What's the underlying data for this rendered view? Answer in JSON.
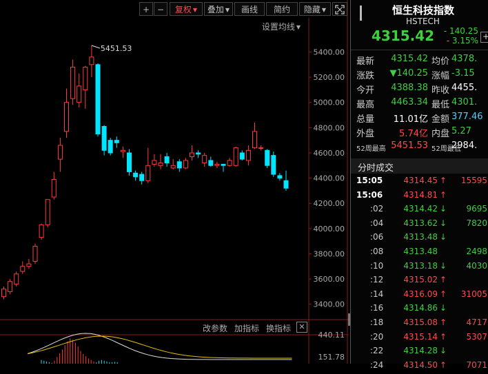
{
  "toolbar": {
    "zoom_in": "+",
    "zoom_out": "−",
    "adjust": "复权",
    "overlay": "叠加",
    "draw": "画线",
    "simplify": "简约",
    "hide": "隐藏",
    "fullscreen_icon": "fullscreen-icon",
    "adjust_color": "#ff4a4a"
  },
  "chart": {
    "ma_setting": "设置均线",
    "high_label": "5451.53",
    "y_ticks": [
      "5400.00",
      "5200.00",
      "5000.00",
      "4800.00",
      "4600.00",
      "4400.00",
      "4200.00",
      "4000.00",
      "3800.00",
      "3600.00",
      "3400.00"
    ],
    "sub_ticks": [
      "440.11",
      "151.78"
    ],
    "sub_toolbar": {
      "param": "改参数",
      "add_indicator": "加指标",
      "change_indicator": "换指标"
    },
    "up_color": "#ff3b3b",
    "down_color": "#00e5ff"
  },
  "chart_data": {
    "type": "candlestick",
    "ylim": [
      3300,
      5550
    ],
    "candles": [
      [
        3460,
        3520,
        3440,
        3540
      ],
      [
        3500,
        3580,
        3480,
        3600
      ],
      [
        3560,
        3640,
        3540,
        3660
      ],
      [
        3660,
        3700,
        3640,
        3740
      ],
      [
        3700,
        3720,
        3680,
        3760
      ],
      [
        3740,
        3860,
        3720,
        3880
      ],
      [
        3930,
        4030,
        3910,
        4040
      ],
      [
        4030,
        4230,
        4010,
        4230
      ],
      [
        4250,
        4390,
        4230,
        4450
      ],
      [
        4550,
        4660,
        4450,
        4720
      ],
      [
        4770,
        5000,
        4720,
        5110
      ],
      [
        5030,
        5280,
        4980,
        5340
      ],
      [
        5000,
        5130,
        4960,
        5230
      ],
      [
        5100,
        5280,
        4950,
        5290
      ],
      [
        5300,
        5360,
        5200,
        5451.53
      ],
      [
        5300,
        4750,
        4730,
        5310
      ],
      [
        4810,
        4620,
        4580,
        4820
      ],
      [
        4700,
        4600,
        4580,
        4720
      ],
      [
        4700,
        4680,
        4640,
        4730
      ],
      [
        4610,
        4620,
        4560,
        4650
      ],
      [
        4600,
        4450,
        4420,
        4630
      ],
      [
        4440,
        4410,
        4380,
        4460
      ],
      [
        4430,
        4380,
        4350,
        4450
      ],
      [
        4380,
        4500,
        4360,
        4640
      ],
      [
        4510,
        4540,
        4490,
        4590
      ],
      [
        4500,
        4520,
        4470,
        4590
      ],
      [
        4570,
        4520,
        4490,
        4600
      ],
      [
        4480,
        4500,
        4470,
        4550
      ],
      [
        4530,
        4480,
        4450,
        4550
      ],
      [
        4480,
        4540,
        4470,
        4560
      ],
      [
        4570,
        4600,
        4540,
        4660
      ],
      [
        4600,
        4590,
        4560,
        4620
      ],
      [
        4520,
        4580,
        4490,
        4600
      ],
      [
        4540,
        4500,
        4490,
        4570
      ],
      [
        4500,
        4510,
        4480,
        4530
      ],
      [
        4510,
        4500,
        4450,
        4510
      ],
      [
        4500,
        4540,
        4490,
        4560
      ],
      [
        4500,
        4640,
        4490,
        4650
      ],
      [
        4600,
        4550,
        4540,
        4620
      ],
      [
        4540,
        4620,
        4500,
        4660
      ],
      [
        4640,
        4770,
        4630,
        4840
      ],
      [
        4640,
        4640,
        4620,
        4660
      ],
      [
        4620,
        4500,
        4480,
        4630
      ],
      [
        4580,
        4430,
        4410,
        4610
      ],
      [
        4420,
        4400,
        4380,
        4440
      ],
      [
        4380,
        4320,
        4300,
        4460
      ]
    ],
    "macd": [
      {
        "v": -10
      },
      {
        "v": -8
      },
      {
        "v": -6
      },
      {
        "v": -4
      },
      {
        "v": -2
      },
      {
        "v": 8
      },
      {
        "v": 18
      },
      {
        "v": 28
      },
      {
        "v": 38
      },
      {
        "v": 50
      },
      {
        "v": 60
      },
      {
        "v": 68
      },
      {
        "v": 64
      },
      {
        "v": 56
      },
      {
        "v": 46
      },
      {
        "v": 34
      },
      {
        "v": 26
      },
      {
        "v": 20
      },
      {
        "v": 14
      },
      {
        "v": 10
      },
      {
        "v": 6
      },
      {
        "v": -4
      },
      {
        "v": -8
      },
      {
        "v": -10
      },
      {
        "v": -8
      },
      {
        "v": -6
      },
      {
        "v": -4
      },
      {
        "v": -4
      },
      {
        "v": -5
      },
      {
        "v": -4
      }
    ]
  },
  "quote": {
    "name": "恒生科技指数",
    "code": "HSTECH",
    "price": "4315.42",
    "change": "- 140.25",
    "change_pct": "- 3.15%",
    "add_icon": "plus-icon",
    "rows": [
      {
        "l1": "最新",
        "v1": "4315.42",
        "c1": "green",
        "l2": "均价",
        "v2": "4378.",
        "c2": "green"
      },
      {
        "l1": "涨跌",
        "v1": "▼140.25",
        "c1": "green",
        "l2": "涨幅",
        "v2": "-3.15",
        "c2": "green"
      },
      {
        "l1": "今开",
        "v1": "4388.38",
        "c1": "green",
        "l2": "昨收",
        "v2": "4455.",
        "c2": "white"
      },
      {
        "l1": "最高",
        "v1": "4463.34",
        "c1": "green",
        "l2": "最低",
        "v2": "4301.",
        "c2": "green"
      },
      {
        "l1": "总量",
        "v1": "11.01亿",
        "c1": "white",
        "l2": "金额",
        "v2": "377.46",
        "c2": "cyan"
      },
      {
        "l1": "外盘",
        "v1": "5.74亿",
        "c1": "red",
        "l2": "内盘",
        "v2": "5.27",
        "c2": "green"
      },
      {
        "l1": "52周最高",
        "v1": "5451.53",
        "c1": "red",
        "l2": "52周最低",
        "v2": "2984.",
        "c2": "white"
      }
    ]
  },
  "ticks": {
    "title": "分时成交",
    "rows": [
      {
        "time": "15:05",
        "price": "4314.45",
        "arrow": "↑",
        "dir": "red",
        "vol": "15595"
      },
      {
        "time": "15:06",
        "price": "4314.81",
        "arrow": "↑",
        "dir": "red",
        "vol": ""
      },
      {
        "time": ":02",
        "price": "4314.42",
        "arrow": "↓",
        "dir": "green",
        "vol": "9695"
      },
      {
        "time": ":04",
        "price": "4313.62",
        "arrow": "↓",
        "dir": "green",
        "vol": "7820"
      },
      {
        "time": ":06",
        "price": "4313.48",
        "arrow": "↓",
        "dir": "green",
        "vol": ""
      },
      {
        "time": ":08",
        "price": "4313.48",
        "arrow": "",
        "dir": "green",
        "vol": "2498"
      },
      {
        "time": ":10",
        "price": "4313.18",
        "arrow": "↓",
        "dir": "green",
        "vol": "4030"
      },
      {
        "time": ":12",
        "price": "4315.02",
        "arrow": "↑",
        "dir": "red",
        "vol": ""
      },
      {
        "time": ":14",
        "price": "4316.09",
        "arrow": "↑",
        "dir": "red",
        "vol": "31005"
      },
      {
        "time": ":16",
        "price": "4314.86",
        "arrow": "↓",
        "dir": "green",
        "vol": ""
      },
      {
        "time": ":18",
        "price": "4315.08",
        "arrow": "↑",
        "dir": "red",
        "vol": "4717"
      },
      {
        "time": ":20",
        "price": "4315.14",
        "arrow": "↑",
        "dir": "red",
        "vol": "5307"
      },
      {
        "time": ":22",
        "price": "4314.28",
        "arrow": "↓",
        "dir": "green",
        "vol": ""
      },
      {
        "time": ":24",
        "price": "4314.50",
        "arrow": "↑",
        "dir": "red",
        "vol": "7071"
      }
    ]
  }
}
